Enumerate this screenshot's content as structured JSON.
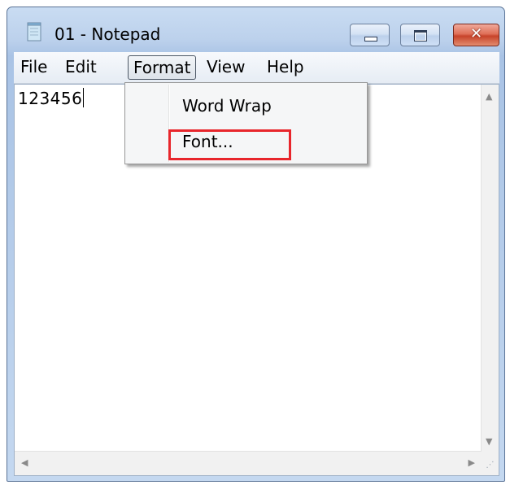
{
  "window": {
    "title": "01 - Notepad",
    "icon": "notepad-icon",
    "controls": {
      "minimize_icon": "minimize-icon",
      "maximize_icon": "maximize-icon",
      "close_glyph": "✕"
    }
  },
  "menubar": {
    "items": [
      {
        "label": "File"
      },
      {
        "label": "Edit"
      },
      {
        "label": "Format",
        "state": "open"
      },
      {
        "label": "View"
      },
      {
        "label": "Help"
      }
    ]
  },
  "format_menu": {
    "items": [
      {
        "label": "Word Wrap"
      },
      {
        "label": "Font..."
      }
    ],
    "highlighted": "Font...",
    "highlight_color": "#e8262c"
  },
  "editor": {
    "content": "123456",
    "scroll_up": "▲",
    "scroll_down": "▼",
    "scroll_left": "◀",
    "scroll_right": "▶"
  },
  "colors": {
    "titlebar": "#bcd1ec",
    "close_button": "#c7432a"
  }
}
